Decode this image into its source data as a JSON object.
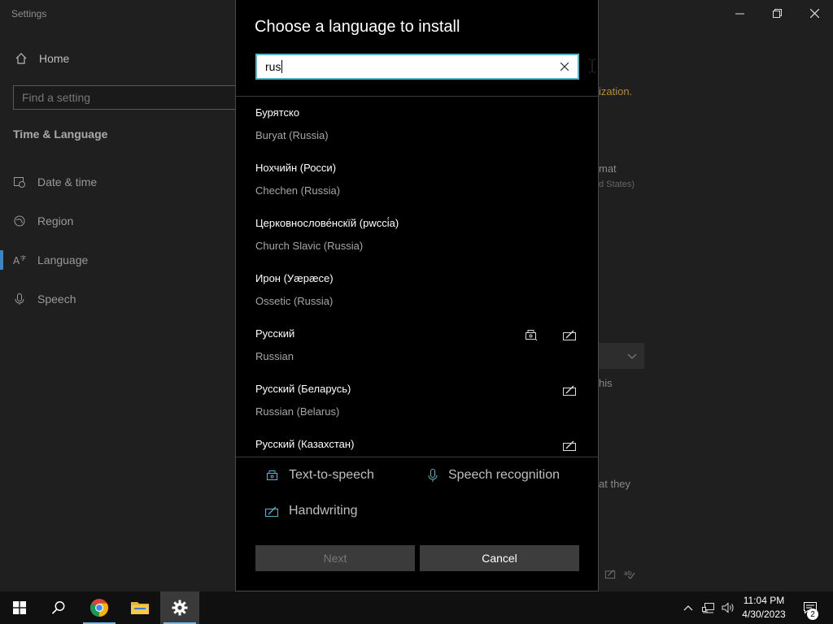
{
  "settings": {
    "title": "Settings",
    "home_label": "Home",
    "search_placeholder": "Find a setting",
    "section_title": "Time & Language",
    "nav": [
      {
        "label": "Date & time",
        "icon": "date-time-icon"
      },
      {
        "label": "Region",
        "icon": "region-icon"
      },
      {
        "label": "Language",
        "icon": "language-icon",
        "active": true
      },
      {
        "label": "Speech",
        "icon": "microphone-icon"
      }
    ],
    "peek_texts": {
      "t1": "ization.",
      "t2": "mat",
      "t3": "d States)",
      "t4": "his",
      "t5": "at they"
    }
  },
  "dialog": {
    "title": "Choose a language to install",
    "search_value": "rus",
    "languages": [
      {
        "native": "Бурятско",
        "english": "Buryat (Russia)",
        "tts": false,
        "handwriting": false
      },
      {
        "native": "Нохчийн (Росси)",
        "english": "Chechen (Russia)",
        "tts": false,
        "handwriting": false
      },
      {
        "native": "Церковнослове́нскїй (рwссі́а)",
        "english": "Church Slavic (Russia)",
        "tts": false,
        "handwriting": false
      },
      {
        "native": "Ирон (Уæрæсе)",
        "english": "Ossetic (Russia)",
        "tts": false,
        "handwriting": false
      },
      {
        "native": "Русский",
        "english": "Russian",
        "tts": true,
        "handwriting": true
      },
      {
        "native": "Русский (Беларусь)",
        "english": "Russian (Belarus)",
        "tts": false,
        "handwriting": true
      },
      {
        "native": "Русский (Казахстан)",
        "english": "",
        "tts": false,
        "handwriting": true
      }
    ],
    "features": {
      "tts": "Text-to-speech",
      "speech": "Speech recognition",
      "handwriting": "Handwriting"
    },
    "next_label": "Next",
    "cancel_label": "Cancel"
  },
  "taskbar": {
    "time": "11:04 PM",
    "date": "4/30/2023",
    "notification_count": "2"
  },
  "colors": {
    "accent": "#57b3c6",
    "taskbar_active_line": "#76b9ed",
    "dialog_bg": "#000000"
  }
}
